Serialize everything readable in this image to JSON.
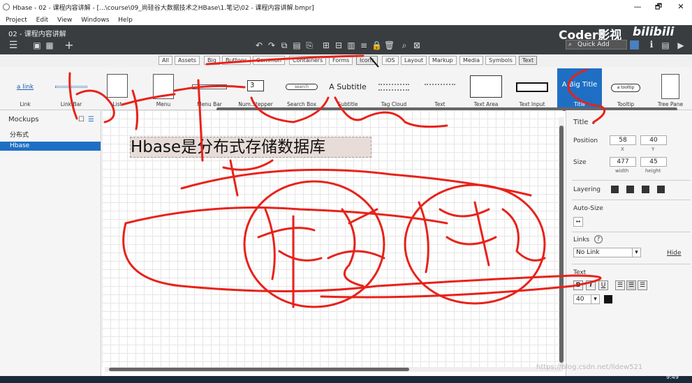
{
  "window": {
    "title": "Hbase - 02 - 课程内容讲解 - [...\\course\\09_尚硅谷大数据技术之HBase\\1.笔记\\02 - 课程内容讲解.bmpr]",
    "minimize": "—",
    "restore": "🗗",
    "close": "✕"
  },
  "menubar": {
    "items": [
      "Project",
      "Edit",
      "View",
      "Windows",
      "Help"
    ]
  },
  "toolbar": {
    "project_name": "02 - 课程内容讲解",
    "brand": "Coder影视",
    "brand_logo": "bilibili",
    "quick_add_placeholder": "Quick Add"
  },
  "filters": [
    "All",
    "Assets",
    "Big",
    "Buttons",
    "Common",
    "Containers",
    "Forms",
    "Icons",
    "iOS",
    "Layout",
    "Markup",
    "Media",
    "Symbols",
    "Text"
  ],
  "library": {
    "items": [
      "Link",
      "Link Bar",
      "List",
      "Menu",
      "Menu Bar",
      "Num.Stepper",
      "Search Box",
      "Subtitle",
      "Tag Cloud",
      "Text",
      "Text Area",
      "Text Input",
      "Title",
      "Tooltip",
      "Tree Pane"
    ],
    "selected": "Title",
    "thumb_texts": {
      "link": "a link",
      "stepper_value": "3",
      "search": "search",
      "subtitle": "A Subtitle",
      "title": "A Big Title",
      "tooltip": "a tooltip"
    }
  },
  "mockups": {
    "header": "Mockups",
    "items": [
      "分布式",
      "Hbase"
    ],
    "selected": "Hbase"
  },
  "canvas": {
    "title_text": "Hbase是分布式存储数据库"
  },
  "properties": {
    "header": "Title",
    "position_label": "Position",
    "x": "58",
    "y": "40",
    "x_label": "X",
    "y_label": "Y",
    "size_label": "Size",
    "width": "477",
    "height": "45",
    "width_label": "width",
    "height_label": "height",
    "layering_label": "Layering",
    "autosize_label": "Auto-Size",
    "links_label": "Links",
    "links_help": "?",
    "link_value": "No Link",
    "hide_label": "Hide",
    "text_label": "Text",
    "bold": "B",
    "italic": "i",
    "underline": "U",
    "font_size": "40"
  },
  "status": {
    "clock": "9:49",
    "watermark": "https://blog.csdn.net/lldew521"
  },
  "colors": {
    "toolbar_bg": "#3a3d40",
    "selection": "#1e6fc4",
    "ink": "#e8221a"
  }
}
